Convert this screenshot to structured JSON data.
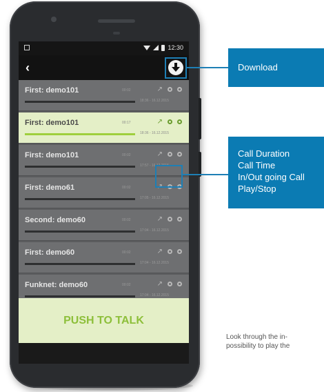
{
  "status_bar": {
    "time": "12:30"
  },
  "app_bar": {
    "back_icon": "back-chevron-icon",
    "download_icon": "download-icon"
  },
  "recordings": [
    {
      "name": "First: demo101",
      "duration": "00:02",
      "time": "18:36 - 16.12.2015",
      "active": false
    },
    {
      "name": "First: demo101",
      "duration": "00:17",
      "time": "18:36 - 16.12.2015",
      "active": true
    },
    {
      "name": "First: demo101",
      "duration": "00:02",
      "time": "17:57 - 16.12.2015",
      "active": false
    },
    {
      "name": "First: demo61",
      "duration": "00:02",
      "time": "17:05 - 16.12.2015",
      "active": false
    },
    {
      "name": "Second: demo60",
      "duration": "00:02",
      "time": "17:04 - 16.12.2015",
      "active": false
    },
    {
      "name": "First: demo60",
      "duration": "00:02",
      "time": "17:04 - 16.12.2015",
      "active": false
    },
    {
      "name": "Funknet: demo60",
      "duration": "00:02",
      "time": "17:04 - 16.12.2015",
      "active": false
    }
  ],
  "push_to_talk": {
    "label": "PUSH TO TALK"
  },
  "callouts": {
    "download": "Download",
    "call_info": [
      "Call Duration",
      "Call Time",
      "In/Out going Call",
      "Play/Stop"
    ]
  },
  "caption": [
    "Look through the in-",
    "possibility to play the"
  ],
  "colors": {
    "accent_blue": "#0b7bb3",
    "active_green": "#9fcf3d",
    "active_bg": "#e4efc7"
  }
}
